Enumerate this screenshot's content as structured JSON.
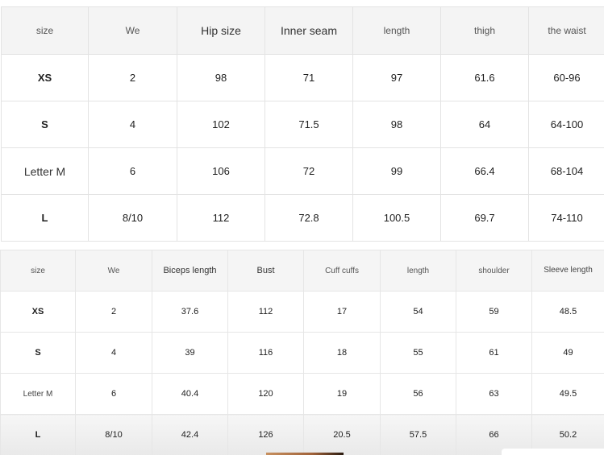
{
  "pants_table": {
    "headers": [
      "size",
      "We",
      "Hip size",
      "Inner seam",
      "length",
      "thigh",
      "the waist"
    ],
    "rows": [
      [
        "XS",
        "2",
        "98",
        "71",
        "97",
        "61.6",
        "60-96"
      ],
      [
        "S",
        "4",
        "102",
        "71.5",
        "98",
        "64",
        "64-100"
      ],
      [
        "Letter M",
        "6",
        "106",
        "72",
        "99",
        "66.4",
        "68-104"
      ],
      [
        "L",
        "8/10",
        "112",
        "72.8",
        "100.5",
        "69.7",
        "74-110"
      ]
    ]
  },
  "tops_table": {
    "headers": [
      "size",
      "We",
      "Biceps length",
      "Bust",
      "Cuff cuffs",
      "length",
      "shoulder",
      "Sleeve length"
    ],
    "rows": [
      [
        "XS",
        "2",
        "37.6",
        "112",
        "17",
        "54",
        "59",
        "48.5"
      ],
      [
        "S",
        "4",
        "39",
        "116",
        "18",
        "55",
        "61",
        "49"
      ],
      [
        "Letter M",
        "6",
        "40.4",
        "120",
        "19",
        "56",
        "63",
        "49.5"
      ],
      [
        "L",
        "8/10",
        "42.4",
        "126",
        "20.5",
        "57.5",
        "66",
        "50.2"
      ]
    ]
  }
}
